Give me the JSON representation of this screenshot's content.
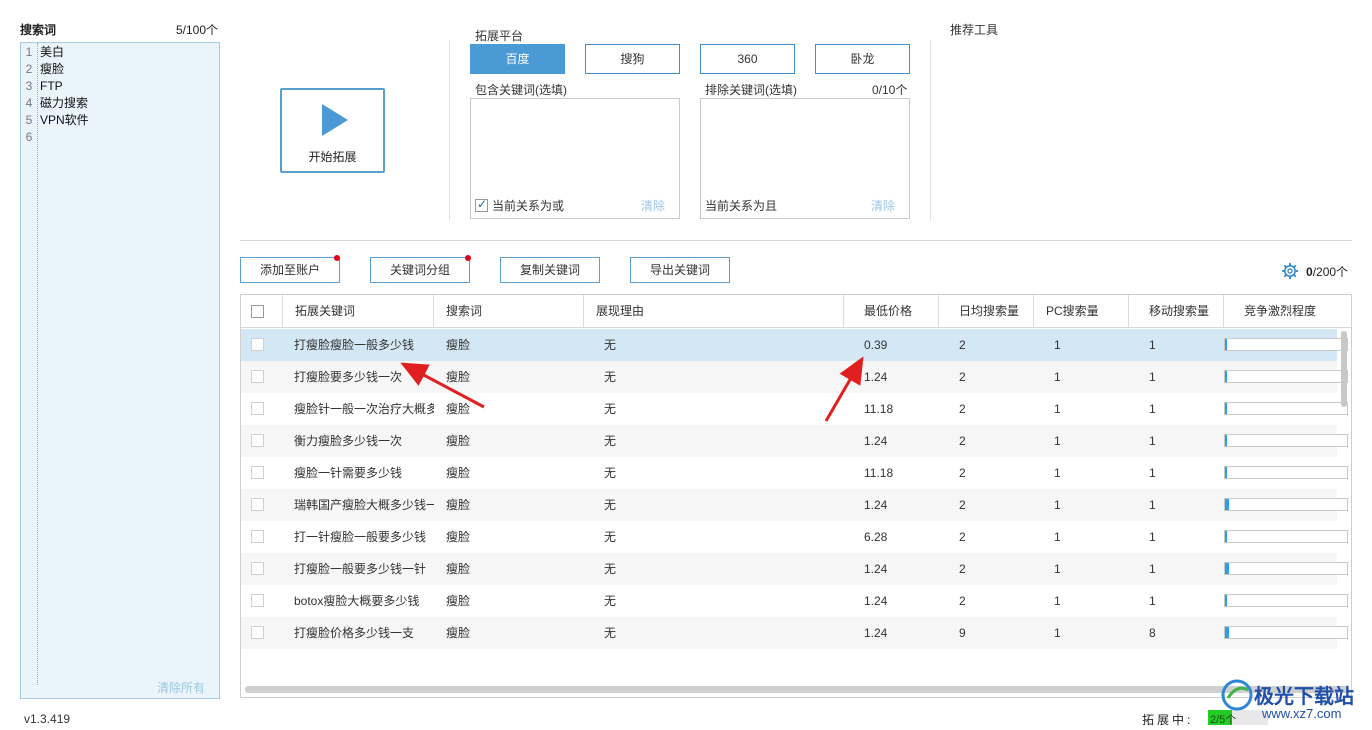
{
  "left": {
    "title": "搜索词",
    "count": "5/100个",
    "lines": [
      {
        "num": "1",
        "text": "美白"
      },
      {
        "num": "2",
        "text": "瘦脸"
      },
      {
        "num": "3",
        "text": "FTP"
      },
      {
        "num": "4",
        "text": "磁力搜索"
      },
      {
        "num": "5",
        "text": "VPN软件"
      },
      {
        "num": "6",
        "text": ""
      }
    ],
    "clear_label": "清除所有",
    "version": "v1.3.419"
  },
  "start": {
    "label": "开始拓展",
    "icon": "play-icon"
  },
  "platform": {
    "title": "拓展平台",
    "buttons": [
      "百度",
      "搜狗",
      "360",
      "卧龙"
    ],
    "active_index": 0
  },
  "include": {
    "title": "包含关键词(选填)",
    "relation": "当前关系为或",
    "relation_checked": true,
    "clear_label": "清除"
  },
  "exclude": {
    "title": "排除关键词(选填)",
    "count": "0/10个",
    "relation": "当前关系为且",
    "clear_label": "清除"
  },
  "recommend": {
    "title": "推荐工具"
  },
  "actions": {
    "add_account": "添加至账户",
    "group": "关键词分组",
    "copy": "复制关键词",
    "export": "导出关键词",
    "total_count": "0",
    "total_suffix": "/200个",
    "settings_icon": "gear-icon"
  },
  "table": {
    "headers": [
      "拓展关键词",
      "搜索词",
      "展现理由",
      "最低价格",
      "日均搜索量",
      "PC搜索量",
      "移动搜索量",
      "竞争激烈程度"
    ],
    "rows": [
      {
        "keyword": "打瘦脸瘦脸一般多少钱",
        "search": "瘦脸",
        "reason": "无",
        "price": "0.39",
        "daily": "2",
        "pc": "1",
        "mobile": "1",
        "competition": 0.01
      },
      {
        "keyword": "打瘦脸要多少钱一次",
        "search": "瘦脸",
        "reason": "无",
        "price": "1.24",
        "daily": "2",
        "pc": "1",
        "mobile": "1",
        "competition": 0.01
      },
      {
        "keyword": "瘦脸针一般一次治疗大概多",
        "search": "瘦脸",
        "reason": "无",
        "price": "11.18",
        "daily": "2",
        "pc": "1",
        "mobile": "1",
        "competition": 0.01
      },
      {
        "keyword": "衡力瘦脸多少钱一次",
        "search": "瘦脸",
        "reason": "无",
        "price": "1.24",
        "daily": "2",
        "pc": "1",
        "mobile": "1",
        "competition": 0.01
      },
      {
        "keyword": "瘦脸一针需要多少钱",
        "search": "瘦脸",
        "reason": "无",
        "price": "11.18",
        "daily": "2",
        "pc": "1",
        "mobile": "1",
        "competition": 0.01
      },
      {
        "keyword": "瑞韩国产瘦脸大概多少钱一",
        "search": "瘦脸",
        "reason": "无",
        "price": "1.24",
        "daily": "2",
        "pc": "1",
        "mobile": "1",
        "competition": 0.03
      },
      {
        "keyword": "打一针瘦脸一般要多少钱",
        "search": "瘦脸",
        "reason": "无",
        "price": "6.28",
        "daily": "2",
        "pc": "1",
        "mobile": "1",
        "competition": 0.01
      },
      {
        "keyword": "打瘦脸一般要多少钱一针",
        "search": "瘦脸",
        "reason": "无",
        "price": "1.24",
        "daily": "2",
        "pc": "1",
        "mobile": "1",
        "competition": 0.03
      },
      {
        "keyword": "botox瘦脸大概要多少钱",
        "search": "瘦脸",
        "reason": "无",
        "price": "1.24",
        "daily": "2",
        "pc": "1",
        "mobile": "1",
        "competition": 0.01
      },
      {
        "keyword": "打瘦脸价格多少钱一支",
        "search": "瘦脸",
        "reason": "无",
        "price": "1.24",
        "daily": "9",
        "pc": "1",
        "mobile": "8",
        "competition": 0.03
      }
    ],
    "selected_row": 0
  },
  "status": {
    "label": "拓展中:",
    "progress_text": "2/5个",
    "progress": 0.4
  },
  "watermark": {
    "big": "极光下载站",
    "small": "www.xz7.com"
  },
  "colors": {
    "accent": "#4a9ad6",
    "annotation_arrow": "#e02020",
    "dot": "#e60012",
    "progress": "#22cc22"
  }
}
